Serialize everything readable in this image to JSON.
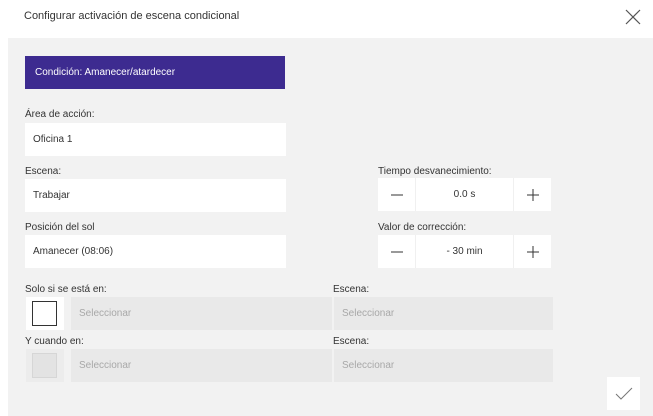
{
  "dialog": {
    "title": "Configurar activación de escena condicional"
  },
  "condition": {
    "button_label": "Condición: Amanecer/atardecer"
  },
  "area": {
    "label": "Área de acción:",
    "value": "Oficina 1"
  },
  "scene": {
    "label": "Escena:",
    "value": "Trabajar"
  },
  "fade_time": {
    "label": "Tiempo desvanecimiento:",
    "value": "0.0 s"
  },
  "sun_position": {
    "label": "Posición del sol",
    "value": "Amanecer (08:06)"
  },
  "correction": {
    "label": "Valor de corrección:",
    "value": "- 30 min"
  },
  "only_if": {
    "label": "Solo si se está en:",
    "placeholder": "Seleccionar",
    "checked": false,
    "scene_label": "Escena:",
    "scene_placeholder": "Seleccionar"
  },
  "and_when": {
    "label": "Y cuando en:",
    "placeholder": "Seleccionar",
    "checked": false,
    "disabled": true,
    "scene_label": "Escena:",
    "scene_placeholder": "Seleccionar"
  },
  "colors": {
    "accent": "#3d2b90",
    "panel_bg": "#f2f2f2",
    "select_bg": "#e9e9e9",
    "placeholder_text": "#a8a8a8"
  },
  "icons": {
    "close": "close-icon",
    "minus": "minus-icon",
    "plus": "plus-icon",
    "confirm": "checkmark-icon"
  }
}
